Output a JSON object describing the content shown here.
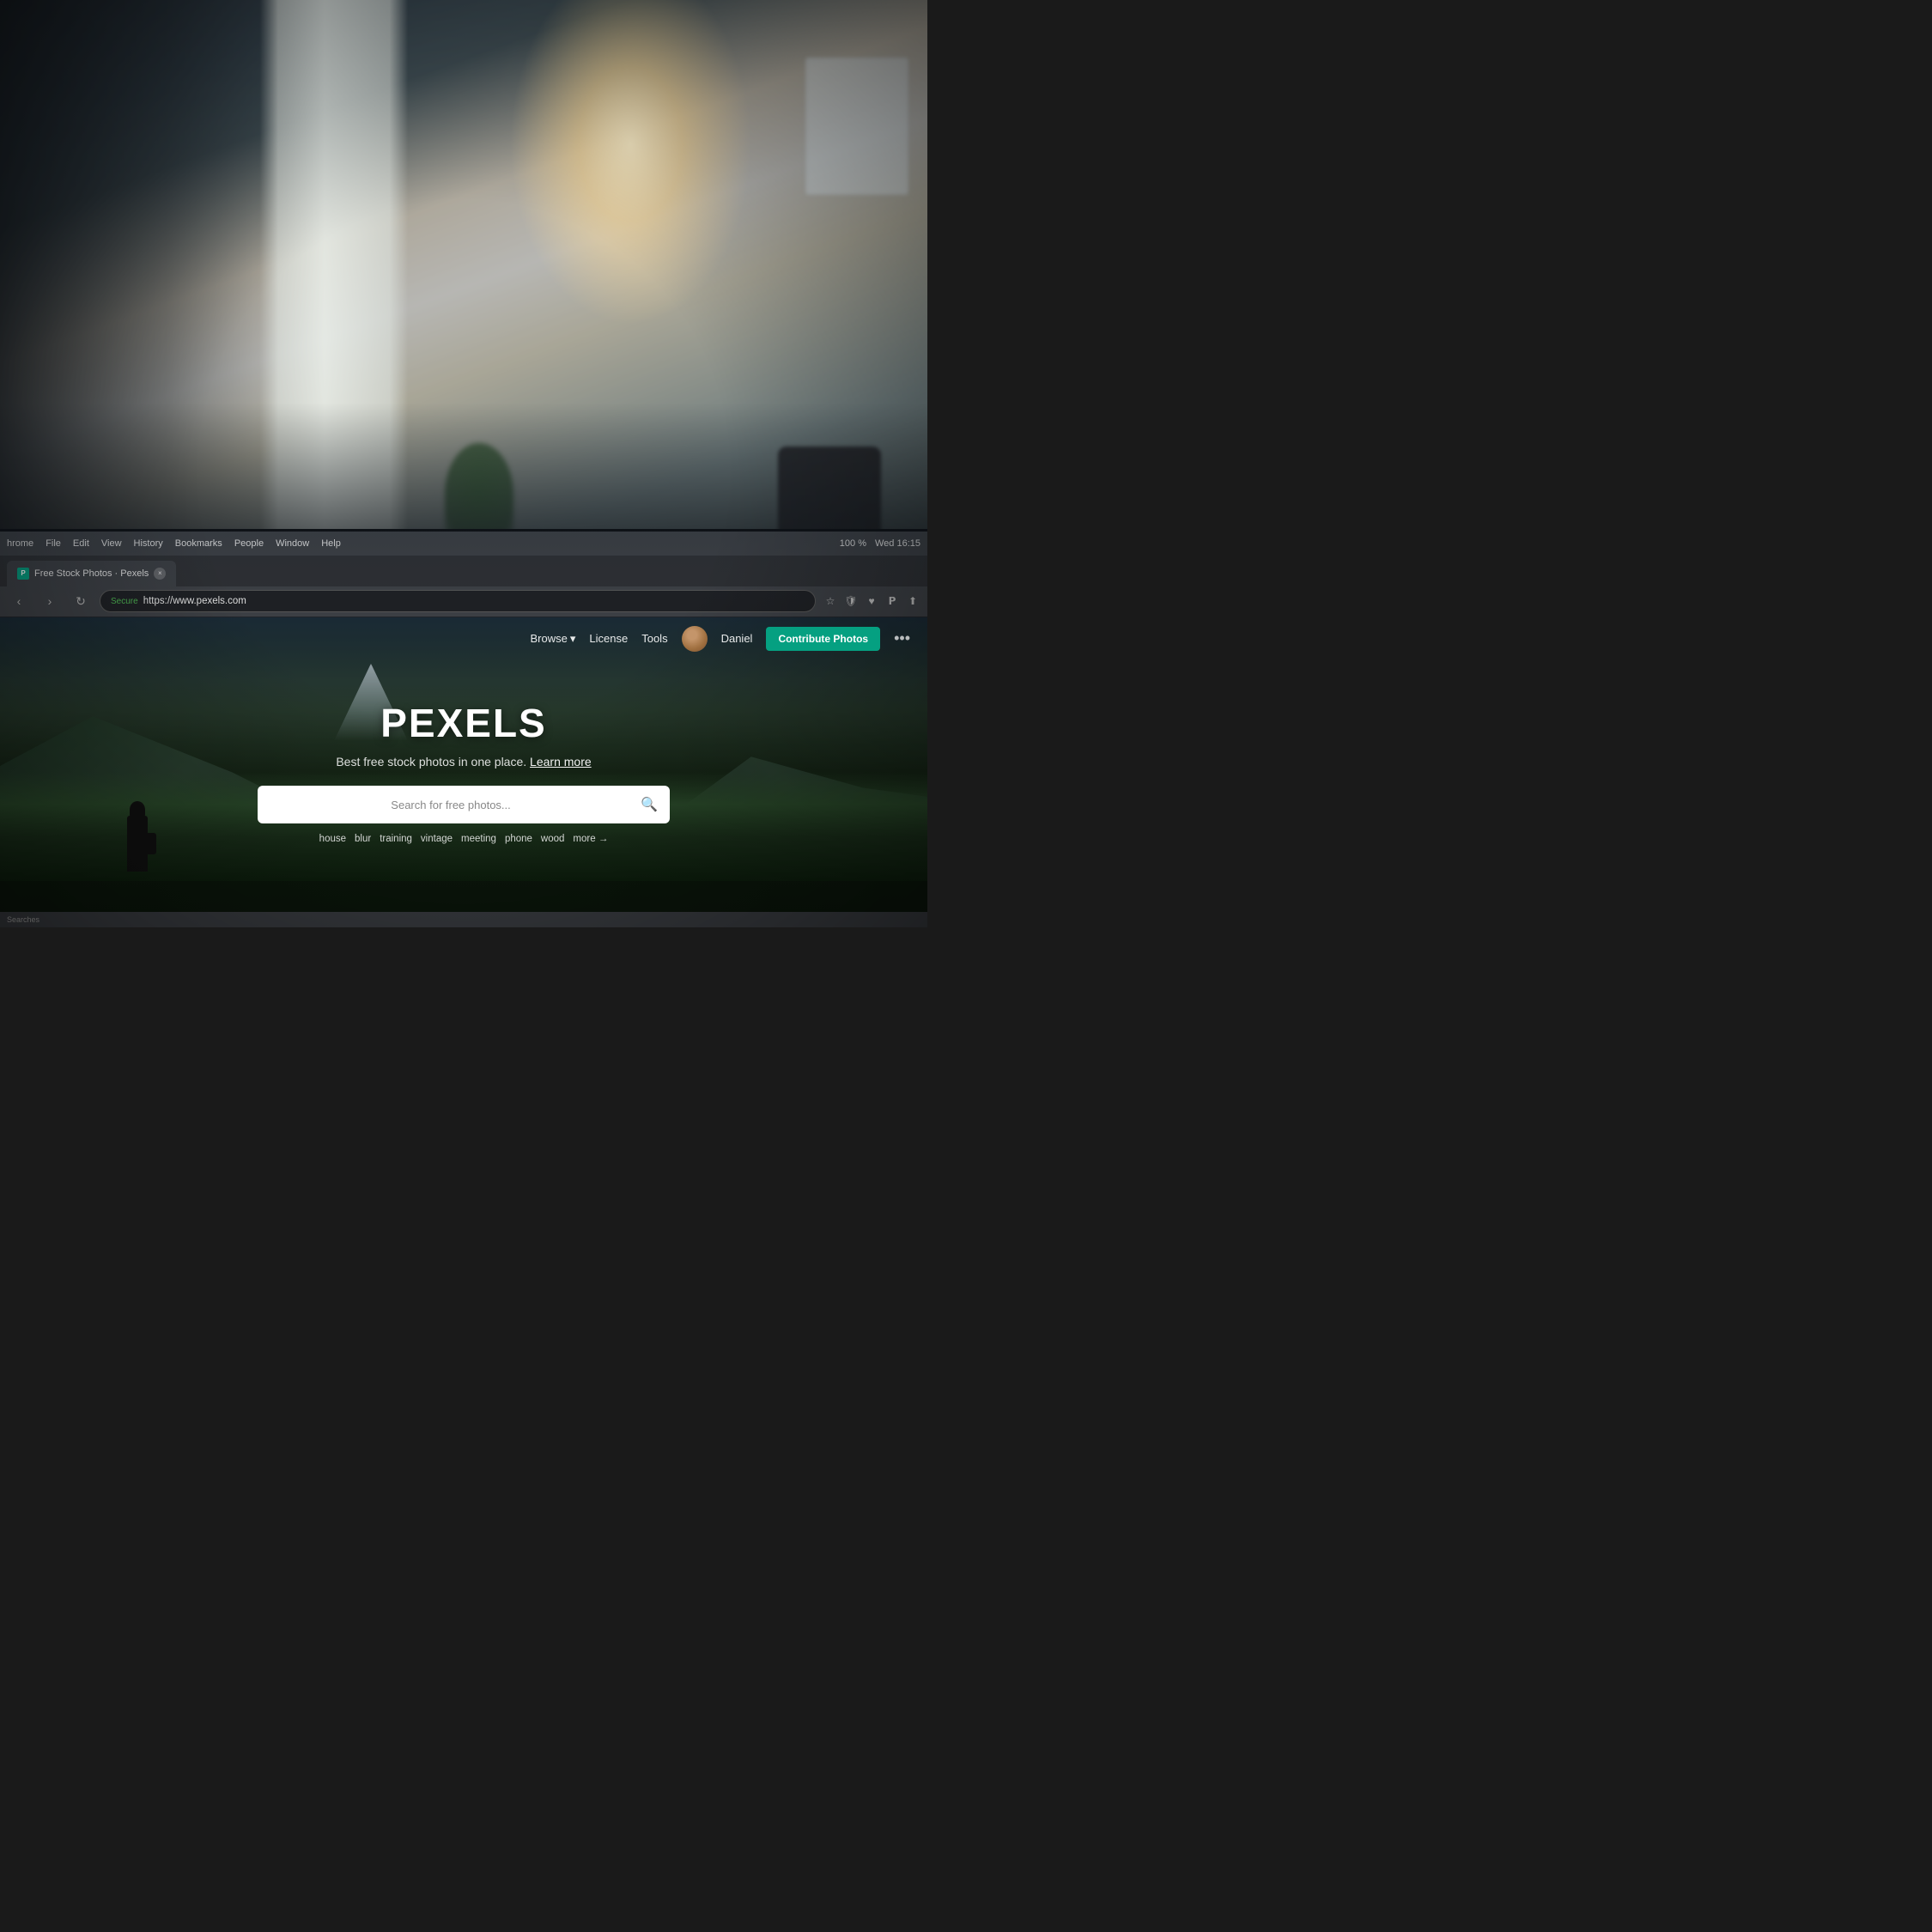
{
  "background": {
    "desc": "Office workspace photo with blurred background, column, plants, windows"
  },
  "menubar": {
    "app": "hrome",
    "items": [
      "File",
      "Edit",
      "View",
      "History",
      "Bookmarks",
      "People",
      "Window",
      "Help"
    ],
    "right": {
      "time": "Wed 16:15",
      "battery": "100 %"
    }
  },
  "tab": {
    "favicon_text": "P",
    "title": "Free Stock Photos · Pexels",
    "close_symbol": "×"
  },
  "addressbar": {
    "back_symbol": "‹",
    "forward_symbol": "›",
    "reload_symbol": "↻",
    "secure_label": "Secure",
    "url": "https://www.pexels.com",
    "star_symbol": "☆"
  },
  "website": {
    "nav": {
      "browse_label": "Browse",
      "browse_chevron": "▾",
      "license_label": "License",
      "tools_label": "Tools",
      "user_label": "Daniel",
      "contribute_label": "Contribute Photos",
      "more_symbol": "•••"
    },
    "hero": {
      "title": "PEXELS",
      "subtitle": "Best free stock photos in one place.",
      "learn_more": "Learn more",
      "search_placeholder": "Search for free photos...",
      "search_icon": "🔍"
    },
    "quick_tags": [
      "house",
      "blur",
      "training",
      "vintage",
      "meeting",
      "phone",
      "wood"
    ],
    "more_label": "more →"
  },
  "statusbar": {
    "text": "Searches"
  }
}
